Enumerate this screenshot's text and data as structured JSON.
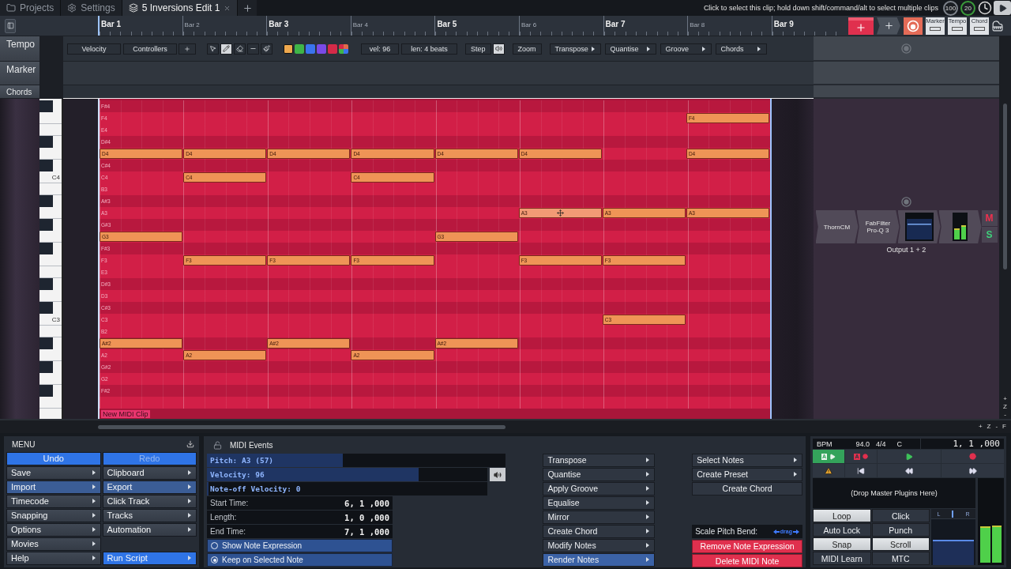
{
  "tabs": [
    {
      "kind": "projects",
      "label": "Projects",
      "selected": false
    },
    {
      "kind": "settings",
      "label": "Settings",
      "selected": false
    },
    {
      "kind": "edit",
      "label": "5 Inversions Edit 1",
      "selected": true
    }
  ],
  "hint": "Click to select this clip; hold down shift/command/alt to select multiple clips",
  "indicators": [
    "100",
    "20"
  ],
  "ruler": {
    "bars": [
      {
        "label": "Bar 1",
        "major": true
      },
      {
        "label": "Bar 2",
        "major": false
      },
      {
        "label": "Bar 3",
        "major": true
      },
      {
        "label": "Bar 4",
        "major": false
      },
      {
        "label": "Bar 5",
        "major": true
      },
      {
        "label": "Bar 6",
        "major": false
      },
      {
        "label": "Bar 7",
        "major": true
      },
      {
        "label": "Bar 8",
        "major": false
      },
      {
        "label": "Bar 9",
        "major": true
      }
    ],
    "toggles": [
      "Marker",
      "Tempo",
      "Chord"
    ]
  },
  "tracks": [
    "Tempo",
    "Marker",
    "Chords"
  ],
  "toolbar": {
    "dropdowns": [
      "Velocity",
      "Controllers"
    ],
    "tools": [
      {
        "kind": "pointer",
        "selected": false
      },
      {
        "kind": "pencil",
        "selected": true
      },
      {
        "kind": "eraser",
        "selected": false
      },
      {
        "kind": "line",
        "selected": false
      },
      {
        "kind": "brush",
        "selected": false
      }
    ],
    "swatches": [
      {
        "kind": "solid",
        "color": "#eea84e",
        "selected": true
      },
      {
        "kind": "solid",
        "color": "#3fb548",
        "selected": false
      },
      {
        "kind": "solid",
        "color": "#3a74ee",
        "selected": false
      },
      {
        "kind": "solid",
        "color": "#7a4ae6",
        "selected": false
      },
      {
        "kind": "solid",
        "color": "#d42a48",
        "selected": false
      },
      {
        "kind": "mixed",
        "selected": false
      }
    ],
    "velocity": "vel: 96",
    "length": "len: 4 beats",
    "step": "Step",
    "zoom": "Zoom",
    "menus": [
      "Transpose",
      "Quantise",
      "Groove",
      "Chords"
    ]
  },
  "piano_roll": {
    "rows": [
      {
        "label": "F#4",
        "black": true
      },
      {
        "label": "F4",
        "black": false,
        "cells": [
          {
            "kind": "empty"
          },
          {
            "kind": "empty"
          },
          {
            "kind": "empty"
          },
          {
            "kind": "empty"
          },
          {
            "kind": "empty"
          },
          {
            "kind": "empty"
          },
          {
            "kind": "empty"
          },
          {
            "kind": "note",
            "text": "F4",
            "selected": false
          }
        ]
      },
      {
        "label": "E4",
        "black": false
      },
      {
        "label": "D#4",
        "black": true
      },
      {
        "black": false,
        "cells": [
          {
            "kind": "note",
            "text": "D4",
            "selected": false
          },
          {
            "kind": "note",
            "text": "D4",
            "selected": false
          },
          {
            "kind": "note",
            "text": "D4",
            "selected": false
          },
          {
            "kind": "note",
            "text": "D4",
            "selected": false
          },
          {
            "kind": "note",
            "text": "D4",
            "selected": false
          },
          {
            "kind": "note",
            "text": "D4",
            "selected": false
          },
          {
            "kind": "empty"
          },
          {
            "kind": "note",
            "text": "D4",
            "selected": false
          }
        ]
      },
      {
        "label": "C#4",
        "black": true
      },
      {
        "label": "C4",
        "black": false,
        "key_label": "C4",
        "cells": [
          {
            "kind": "empty"
          },
          {
            "kind": "note",
            "text": "C4",
            "selected": false
          },
          {
            "kind": "empty"
          },
          {
            "kind": "note",
            "text": "C4",
            "selected": false
          },
          {
            "kind": "empty"
          },
          {
            "kind": "empty"
          },
          {
            "kind": "empty"
          },
          {
            "kind": "empty"
          }
        ]
      },
      {
        "label": "B3",
        "black": false
      },
      {
        "label": "A#3",
        "black": true
      },
      {
        "label": "A3",
        "black": false,
        "cells": [
          {
            "kind": "empty"
          },
          {
            "kind": "empty"
          },
          {
            "kind": "empty"
          },
          {
            "kind": "empty"
          },
          {
            "kind": "empty"
          },
          {
            "kind": "note",
            "text": "A3",
            "selected": true
          },
          {
            "kind": "note",
            "text": "A3",
            "selected": false
          },
          {
            "kind": "note",
            "text": "A3",
            "selected": false
          }
        ]
      },
      {
        "label": "G#3",
        "black": true
      },
      {
        "black": false,
        "cells": [
          {
            "kind": "note",
            "text": "G3",
            "selected": false
          },
          {
            "kind": "empty"
          },
          {
            "kind": "empty"
          },
          {
            "kind": "empty"
          },
          {
            "kind": "note",
            "text": "G3",
            "selected": false
          },
          {
            "kind": "empty"
          },
          {
            "kind": "empty"
          },
          {
            "kind": "empty"
          }
        ]
      },
      {
        "label": "F#3",
        "black": true
      },
      {
        "label": "F3",
        "black": false,
        "cells": [
          {
            "kind": "empty"
          },
          {
            "kind": "note",
            "text": "F3",
            "selected": false
          },
          {
            "kind": "note",
            "text": "F3",
            "selected": false
          },
          {
            "kind": "note",
            "text": "F3",
            "selected": false
          },
          {
            "kind": "empty"
          },
          {
            "kind": "note",
            "text": "F3",
            "selected": false
          },
          {
            "kind": "note",
            "text": "F3",
            "selected": false
          },
          {
            "kind": "empty"
          }
        ]
      },
      {
        "label": "E3",
        "black": false
      },
      {
        "label": "D#3",
        "black": true
      },
      {
        "label": "D3",
        "black": false
      },
      {
        "label": "C#3",
        "black": true
      },
      {
        "label": "C3",
        "black": false,
        "key_label": "C3",
        "cells": [
          {
            "kind": "empty"
          },
          {
            "kind": "empty"
          },
          {
            "kind": "empty"
          },
          {
            "kind": "empty"
          },
          {
            "kind": "empty"
          },
          {
            "kind": "empty"
          },
          {
            "kind": "note",
            "text": "C3",
            "selected": false
          },
          {
            "kind": "empty"
          }
        ]
      },
      {
        "label": "B2",
        "black": false
      },
      {
        "black": true,
        "cells": [
          {
            "kind": "note",
            "text": "A#2",
            "selected": false
          },
          {
            "kind": "empty"
          },
          {
            "kind": "note",
            "text": "A#2",
            "selected": false
          },
          {
            "kind": "empty"
          },
          {
            "kind": "note",
            "text": "A#2",
            "selected": false
          },
          {
            "kind": "empty"
          },
          {
            "kind": "empty"
          },
          {
            "kind": "empty"
          }
        ]
      },
      {
        "label": "A2",
        "black": false,
        "cells": [
          {
            "kind": "empty"
          },
          {
            "kind": "note",
            "text": "A2",
            "selected": false
          },
          {
            "kind": "empty"
          },
          {
            "kind": "note",
            "text": "A2",
            "selected": false
          },
          {
            "kind": "empty"
          },
          {
            "kind": "empty"
          },
          {
            "kind": "empty"
          },
          {
            "kind": "empty"
          }
        ]
      },
      {
        "label": "G#2",
        "black": true
      },
      {
        "label": "G2",
        "black": false
      },
      {
        "label": "F#2",
        "black": true
      },
      {
        "black": false
      }
    ],
    "clip_name": "New MIDI Clip"
  },
  "mixer": {
    "plugins": [
      "ThornCM",
      "FabFilter Pro-Q 3"
    ],
    "meter": [
      {
        "level": 0.45
      },
      {
        "level": 0.55
      }
    ],
    "mute": "M",
    "solo": "S",
    "output": "Output 1 + 2"
  },
  "scroll_zoom": {
    "horizontal": [
      "+",
      "Z",
      "-",
      "F"
    ],
    "vertical": [
      "+",
      "Z",
      "-"
    ]
  },
  "menu": {
    "title": "MENU",
    "items": [
      {
        "label": "Undo",
        "kind": "primary",
        "submenu": false,
        "disabled": false
      },
      {
        "label": "Redo",
        "kind": "primary",
        "submenu": false,
        "disabled": true
      },
      {
        "label": "Save",
        "kind": "plain",
        "submenu": true,
        "disabled": false
      },
      {
        "label": "Clipboard",
        "kind": "plain",
        "submenu": true,
        "disabled": false
      },
      {
        "label": "Import",
        "kind": "accent",
        "submenu": true,
        "disabled": false
      },
      {
        "label": "Export",
        "kind": "accent",
        "submenu": true,
        "disabled": false
      },
      {
        "label": "Timecode",
        "kind": "plain",
        "submenu": true,
        "disabled": false
      },
      {
        "label": "Click Track",
        "kind": "plain",
        "submenu": true,
        "disabled": false
      },
      {
        "label": "Snapping",
        "kind": "plain",
        "submenu": true,
        "disabled": false
      },
      {
        "label": "Tracks",
        "kind": "plain",
        "submenu": true,
        "disabled": false
      },
      {
        "label": "Options",
        "kind": "plain",
        "submenu": true,
        "disabled": false
      },
      {
        "label": "Automation",
        "kind": "plain",
        "submenu": true,
        "disabled": false
      },
      {
        "label": "Movies",
        "kind": "plain",
        "submenu": true,
        "disabled": false
      },
      {
        "kind": "blank"
      },
      {
        "label": "Help",
        "kind": "plain",
        "submenu": true,
        "disabled": false
      },
      {
        "label": "Run Script",
        "kind": "primary",
        "submenu": true,
        "disabled": false
      }
    ]
  },
  "midi_events": {
    "title": "MIDI Events",
    "bars": [
      {
        "kind": "plain",
        "label": "Pitch: A3 (57)",
        "level": 0.45
      },
      {
        "kind": "audition",
        "label": "Velocity: 96",
        "level": 0.75
      },
      {
        "kind": "plain",
        "label": "Note-off Velocity: 0",
        "level": 0
      }
    ],
    "fields": [
      {
        "label": "Start Time:",
        "value": "6, 1 ,000"
      },
      {
        "label": "Length:",
        "value": "1, 0 ,000"
      },
      {
        "label": "End Time:",
        "value": "7, 1 ,000"
      }
    ],
    "options": [
      {
        "label": "Show Note Expression",
        "checked": false
      },
      {
        "label": "Keep on Selected Note",
        "checked": true
      }
    ],
    "actions": [
      {
        "label": "Transpose",
        "selected": false
      },
      {
        "label": "Quantise",
        "selected": false
      },
      {
        "label": "Apply Groove",
        "selected": false
      },
      {
        "label": "Equalise",
        "selected": false
      },
      {
        "label": "Mirror",
        "selected": false
      },
      {
        "label": "Create Chord",
        "selected": false
      },
      {
        "label": "Modify Notes",
        "selected": false
      },
      {
        "label": "Render Notes",
        "selected": true
      }
    ],
    "note_menus": [
      {
        "label": "Select Notes",
        "kind": "submenu"
      },
      {
        "label": "Create Preset",
        "kind": "submenu"
      },
      {
        "label": "Create Chord",
        "kind": "action"
      }
    ],
    "pitch_bend": {
      "label": "Scale Pitch Bend:",
      "hint": "drag"
    },
    "danger": [
      "Remove Note Expression",
      "Delete MIDI Note"
    ]
  },
  "transport": {
    "bpm_label": "BPM",
    "bpm": "94.0",
    "signature": "4/4",
    "key": "C",
    "position": "1, 1 ,000",
    "buttons": [
      {
        "kind": "auto-play",
        "text": "A"
      },
      {
        "kind": "auto-record",
        "text": "A"
      },
      {
        "kind": "play"
      },
      {
        "kind": "record"
      },
      {
        "kind": "warning"
      },
      {
        "kind": "to-start"
      },
      {
        "kind": "rewind"
      },
      {
        "kind": "forward"
      }
    ],
    "drop_hint": "(Drop Master Plugins Here)",
    "toggles": [
      {
        "label": "Loop",
        "on": true
      },
      {
        "label": "Click",
        "on": false
      },
      {
        "label": "Auto Lock",
        "on": false
      },
      {
        "label": "Punch",
        "on": false
      },
      {
        "label": "Snap",
        "on": true
      },
      {
        "label": "Scroll",
        "on": true
      },
      {
        "label": "MIDI Learn",
        "on": false
      },
      {
        "label": "MTC",
        "on": false
      }
    ],
    "fader": {
      "left": "L",
      "right": "R",
      "level": 0.55
    },
    "meter": [
      {
        "level": 0.44
      },
      {
        "level": 0.45
      }
    ]
  }
}
